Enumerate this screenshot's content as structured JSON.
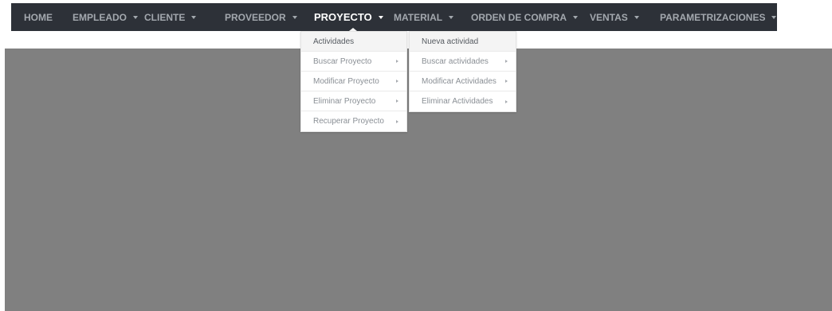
{
  "nav": {
    "items": [
      {
        "label": "HOME"
      },
      {
        "label": "EMPLEADO"
      },
      {
        "label": "CLIENTE"
      },
      {
        "label": "PROVEEDOR"
      },
      {
        "label": "PROYECTO"
      },
      {
        "label": "MATERIAL"
      },
      {
        "label": "ORDEN DE COMPRA"
      },
      {
        "label": "VENTAS"
      },
      {
        "label": "PARAMETRIZACIONES"
      }
    ],
    "active": "PROYECTO"
  },
  "proyecto_menu": {
    "items": [
      {
        "label": "Actividades"
      },
      {
        "label": "Buscar Proyecto"
      },
      {
        "label": "Modificar Proyecto"
      },
      {
        "label": "Eliminar Proyecto"
      },
      {
        "label": "Recuperar Proyecto"
      }
    ]
  },
  "actividades_menu": {
    "items": [
      {
        "label": "Nueva actividad"
      },
      {
        "label": "Buscar actividades"
      },
      {
        "label": "Modificar Actividades"
      },
      {
        "label": "Eliminar Actividades"
      }
    ]
  },
  "colors": {
    "navbar": "#2d3138",
    "nav_text": "#a3a8ae",
    "nav_active_text": "#ffffff",
    "content_background": "#808080",
    "dropdown_background": "#ffffff"
  }
}
